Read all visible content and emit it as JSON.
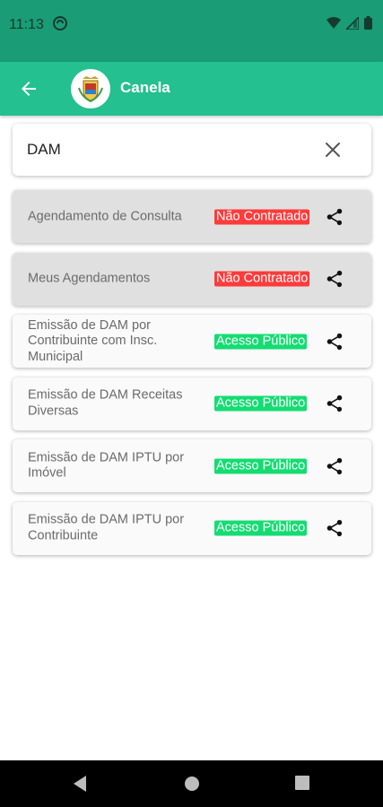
{
  "status_bar": {
    "time": "11:13",
    "icons": [
      "sync-icon",
      "wifi-icon",
      "signal-icon",
      "battery-icon"
    ]
  },
  "app_bar": {
    "title": "Canela",
    "back_icon": "arrow-left-icon",
    "logo": "municipal-crest-logo"
  },
  "search": {
    "value": "DAM",
    "clear_icon": "close-icon"
  },
  "items": [
    {
      "label": "Agendamento de Consulta",
      "badge": "Não Contratado",
      "status": "not-contracted",
      "badge_color": "#ff3b3b"
    },
    {
      "label": "Meus Agendamentos",
      "badge": "Não Contratado",
      "status": "not-contracted",
      "badge_color": "#ff3b3b"
    },
    {
      "label": "Emissão de DAM por Contribuinte com Insc. Municipal",
      "badge": "Acesso Público",
      "status": "public",
      "badge_color": "#14dc72"
    },
    {
      "label": "Emissão de DAM Receitas Diversas",
      "badge": "Acesso Público",
      "status": "public",
      "badge_color": "#14dc72"
    },
    {
      "label": "Emissão de DAM IPTU por Imóvel",
      "badge": "Acesso Público",
      "status": "public",
      "badge_color": "#14dc72"
    },
    {
      "label": "Emissão de DAM IPTU por Contribuinte",
      "badge": "Acesso Público",
      "status": "public",
      "badge_color": "#14dc72"
    }
  ],
  "nav_bar": {
    "icons": [
      "back-triangle-icon",
      "home-circle-icon",
      "recents-square-icon"
    ]
  },
  "colors": {
    "status_bar": "#1a9c76",
    "app_bar": "#25c08f",
    "not_contracted": "#ff3b3b",
    "public": "#14dc72"
  }
}
